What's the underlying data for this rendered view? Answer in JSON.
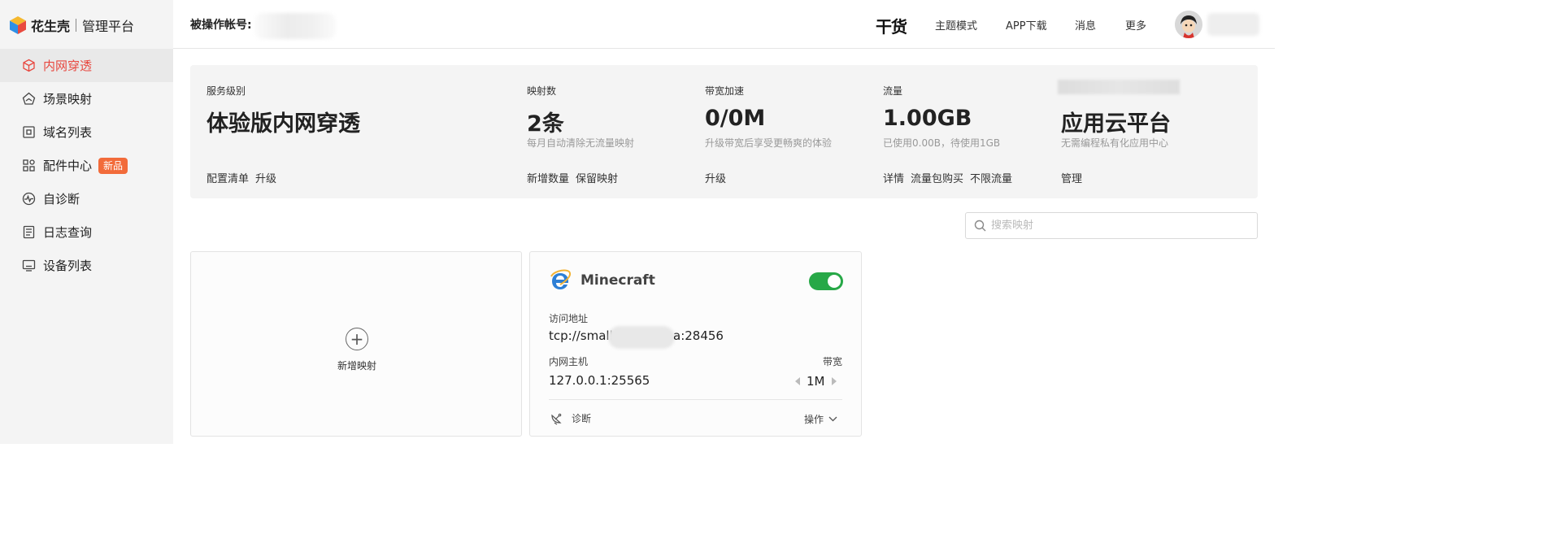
{
  "sidebar": {
    "logo": {
      "brand": "花生壳",
      "sub": "管理平台"
    },
    "items": [
      {
        "label": "内网穿透",
        "icon": "cube-icon",
        "active": true
      },
      {
        "label": "场景映射",
        "icon": "house-icon"
      },
      {
        "label": "域名列表",
        "icon": "domain-icon"
      },
      {
        "label": "配件中心",
        "icon": "grid-icon",
        "badge": "新品"
      },
      {
        "label": "自诊断",
        "icon": "pulse-icon"
      },
      {
        "label": "日志查询",
        "icon": "document-icon"
      },
      {
        "label": "设备列表",
        "icon": "monitor-icon"
      }
    ]
  },
  "header": {
    "account_label": "被操作帐号:",
    "nav": [
      "干货",
      "主题模式",
      "APP下载",
      "消息",
      "更多"
    ]
  },
  "summary": {
    "columns": [
      {
        "label": "服务级别",
        "value": "体验版内网穿透",
        "desc": "",
        "actions": [
          "配置清单",
          "升级"
        ]
      },
      {
        "label": "映射数",
        "value": "2条",
        "desc": "每月自动清除无流量映射",
        "actions": [
          "新增数量",
          "保留映射"
        ]
      },
      {
        "label": "带宽加速",
        "value": "0/0M",
        "desc": "升级带宽后享受更畅爽的体验",
        "actions": [
          "升级"
        ]
      },
      {
        "label": "流量",
        "value": "1.00GB",
        "desc": "已使用0.00B，待使用1GB",
        "actions": [
          "详情",
          "流量包购买",
          "不限流量"
        ]
      },
      {
        "label": "",
        "value": "应用云平台",
        "desc": "无需编程私有化应用中心",
        "actions": [
          "管理"
        ]
      }
    ]
  },
  "search": {
    "placeholder": "搜索映射"
  },
  "add_card": {
    "label": "新增映射"
  },
  "mapping": {
    "name": "Minecraft",
    "enabled": true,
    "address_label": "访问地址",
    "address_prefix": "tcp://small",
    "address_suffix": "a:28456",
    "host_label": "内网主机",
    "host": "127.0.0.1:25565",
    "bandwidth_label": "带宽",
    "bandwidth": "1M",
    "diagnose": "诊断",
    "operations": "操作",
    "accent": "#27a847"
  },
  "colors": {
    "active": "#e8473f",
    "badge": "#f26b3a"
  }
}
